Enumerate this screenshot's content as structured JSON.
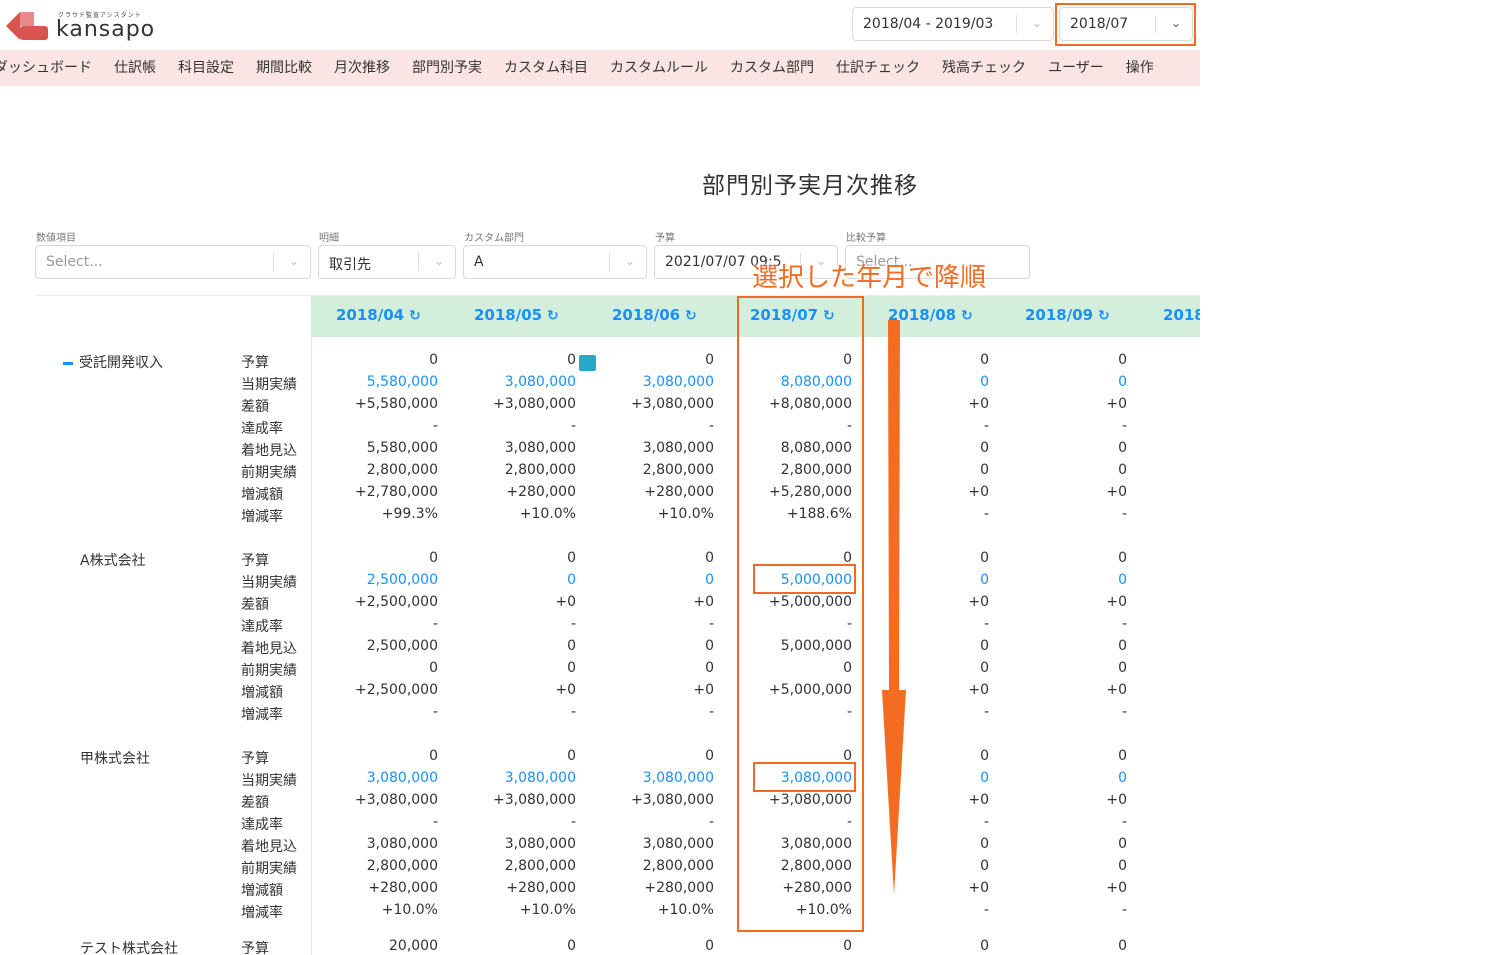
{
  "header": {
    "logo_sub": "クラウド監査アシスタント",
    "logo_text": "kansapo",
    "period_range": "2018/04 - 2019/03",
    "selected_month": "2018/07"
  },
  "nav": [
    "ダッシュボード",
    "仕訳帳",
    "科目設定",
    "期間比較",
    "月次推移",
    "部門別予実",
    "カスタム科目",
    "カスタムルール",
    "カスタム部門",
    "仕訳チェック",
    "残高チェック",
    "ユーザー",
    "操作"
  ],
  "page_title": "部門別予実月次推移",
  "filters": {
    "value_item": {
      "label": "数値項目",
      "value": "Select..."
    },
    "detail": {
      "label": "明細",
      "value": "取引先"
    },
    "custom_dept": {
      "label": "カスタム部門",
      "value": "A"
    },
    "budget": {
      "label": "予算",
      "value": "2021/07/07 09:5"
    },
    "compare_budget": {
      "label": "比較予算",
      "value": "Select..."
    }
  },
  "months": [
    "2018/04",
    "2018/05",
    "2018/06",
    "2018/07",
    "2018/08",
    "2018/09",
    "2018"
  ],
  "row_labels": [
    "予算",
    "当期実績",
    "差額",
    "達成率",
    "着地見込",
    "前期実績",
    "増減額",
    "増減率"
  ],
  "groups": [
    {
      "name": "受託開発収入",
      "collapsible": true,
      "rows": [
        [
          "0",
          "0",
          "0",
          "0",
          "0",
          "0"
        ],
        [
          "5,580,000",
          "3,080,000",
          "3,080,000",
          "8,080,000",
          "0",
          "0"
        ],
        [
          "+5,580,000",
          "+3,080,000",
          "+3,080,000",
          "+8,080,000",
          "+0",
          "+0"
        ],
        [
          "-",
          "-",
          "-",
          "-",
          "-",
          "-"
        ],
        [
          "5,580,000",
          "3,080,000",
          "3,080,000",
          "8,080,000",
          "0",
          "0"
        ],
        [
          "2,800,000",
          "2,800,000",
          "2,800,000",
          "2,800,000",
          "0",
          "0"
        ],
        [
          "+2,780,000",
          "+280,000",
          "+280,000",
          "+5,280,000",
          "+0",
          "+0"
        ],
        [
          "+99.3%",
          "+10.0%",
          "+10.0%",
          "+188.6%",
          "-",
          "-"
        ]
      ]
    },
    {
      "name": "A株式会社",
      "collapsible": false,
      "rows": [
        [
          "0",
          "0",
          "0",
          "0",
          "0",
          "0"
        ],
        [
          "2,500,000",
          "0",
          "0",
          "5,000,000",
          "0",
          "0"
        ],
        [
          "+2,500,000",
          "+0",
          "+0",
          "+5,000,000",
          "+0",
          "+0"
        ],
        [
          "-",
          "-",
          "-",
          "-",
          "-",
          "-"
        ],
        [
          "2,500,000",
          "0",
          "0",
          "5,000,000",
          "0",
          "0"
        ],
        [
          "0",
          "0",
          "0",
          "0",
          "0",
          "0"
        ],
        [
          "+2,500,000",
          "+0",
          "+0",
          "+5,000,000",
          "+0",
          "+0"
        ],
        [
          "-",
          "-",
          "-",
          "-",
          "-",
          "-"
        ]
      ]
    },
    {
      "name": "甲株式会社",
      "collapsible": false,
      "rows": [
        [
          "0",
          "0",
          "0",
          "0",
          "0",
          "0"
        ],
        [
          "3,080,000",
          "3,080,000",
          "3,080,000",
          "3,080,000",
          "0",
          "0"
        ],
        [
          "+3,080,000",
          "+3,080,000",
          "+3,080,000",
          "+3,080,000",
          "+0",
          "+0"
        ],
        [
          "-",
          "-",
          "-",
          "-",
          "-",
          "-"
        ],
        [
          "3,080,000",
          "3,080,000",
          "3,080,000",
          "3,080,000",
          "0",
          "0"
        ],
        [
          "2,800,000",
          "2,800,000",
          "2,800,000",
          "2,800,000",
          "0",
          "0"
        ],
        [
          "+280,000",
          "+280,000",
          "+280,000",
          "+280,000",
          "+0",
          "+0"
        ],
        [
          "+10.0%",
          "+10.0%",
          "+10.0%",
          "+10.0%",
          "-",
          "-"
        ]
      ]
    },
    {
      "name": "テスト株式会社",
      "collapsible": false,
      "rows": [
        [
          "20,000",
          "0",
          "0",
          "0",
          "0",
          "0"
        ]
      ]
    }
  ],
  "annotation": "選択した年月で降順",
  "colors": {
    "accent": "#1890ff",
    "annotation": "#f36c21",
    "nav_bg": "#fbe4e4",
    "header_bg": "#d3efdb"
  }
}
